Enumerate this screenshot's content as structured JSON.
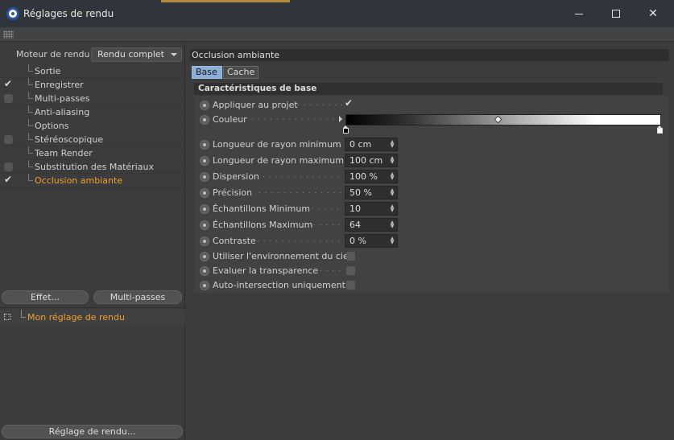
{
  "window": {
    "title": "Réglages de rendu",
    "controls": [
      "minimize",
      "maximize",
      "close"
    ]
  },
  "left_panel": {
    "engine_label": "Moteur de rendu",
    "engine_value": "Rendu complet",
    "tree_items": [
      {
        "label": "Sortie",
        "checkbox": "none"
      },
      {
        "label": "Enregistrer",
        "checkbox": "checked"
      },
      {
        "label": "Multi-passes",
        "checkbox": "unchecked"
      },
      {
        "label": "Anti-aliasing",
        "checkbox": "none"
      },
      {
        "label": "Options",
        "checkbox": "none"
      },
      {
        "label": "Stéréoscopique",
        "checkbox": "unchecked"
      },
      {
        "label": "Team Render",
        "checkbox": "none"
      },
      {
        "label": "Substitution des Matériaux",
        "checkbox": "unchecked"
      },
      {
        "label": "Occlusion ambiante",
        "checkbox": "checked",
        "active": true
      }
    ],
    "effect_button": "Effet...",
    "multipass_button": "Multi-passes",
    "preset_label": "Mon réglage de rendu",
    "preset_button": "Réglage de rendu..."
  },
  "right_panel": {
    "section_title": "Occlusion ambiante",
    "tabs": [
      {
        "label": "Base",
        "active": true
      },
      {
        "label": "Cache",
        "active": false
      }
    ],
    "group_title": "Caractéristiques de base",
    "params": {
      "apply_project": {
        "label": "Appliquer au projet",
        "dots": ". . . . . . . . .",
        "checked": true
      },
      "color": {
        "label": "Couleur",
        "dots": ". . . . . . . . . . . . . . . . . ."
      },
      "min_ray": {
        "label": "Longueur de rayon minimum",
        "dots": ".",
        "value": "0 cm"
      },
      "max_ray": {
        "label": "Longueur de rayon maximum",
        "dots": ".",
        "value": "100 cm"
      },
      "dispersion": {
        "label": "Dispersion",
        "dots": ". . . . . . . . . . . . . . .",
        "value": "100 %"
      },
      "precision": {
        "label": "Précision",
        "dots": ". . . . . . . . . . . . . . . .",
        "value": "50 %"
      },
      "min_samples": {
        "label": "Échantillons Minimum",
        "dots": ". . . . . . .",
        "value": "10"
      },
      "max_samples": {
        "label": "Échantillons Maximum",
        "dots": ". . . . . . .",
        "value": "64"
      },
      "contrast": {
        "label": "Contraste",
        "dots": ". . . . . . . . . . . . . . . . .",
        "value": "0 %"
      },
      "sky_env": {
        "label": "Utiliser l'environnement du ciel",
        "checked": false
      },
      "transparency": {
        "label": "Evaluer la transparence",
        "dots": ". . . . . . . .",
        "checked": false
      },
      "self_intersection": {
        "label": "Auto-intersection uniquement",
        "checked": false
      }
    }
  },
  "colors": {
    "accent_active": "#f0a030",
    "tab_active": "#8aaed6",
    "title_bar": "#30353b"
  }
}
